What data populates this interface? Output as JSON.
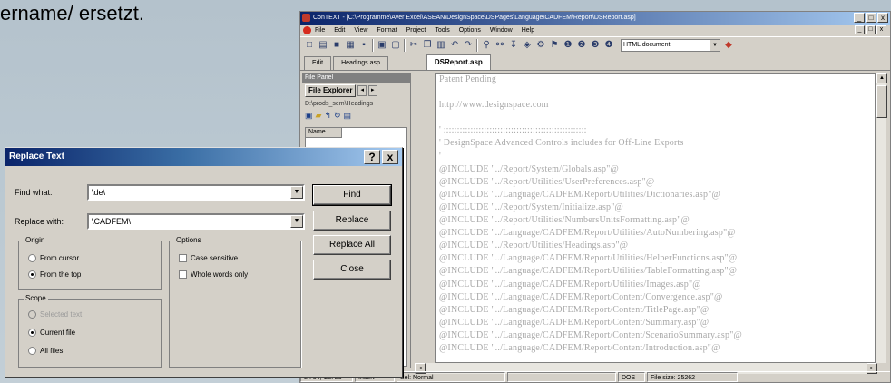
{
  "slide": {
    "caption": "ername/ ersetzt."
  },
  "window": {
    "title": "ConTEXT - [C:\\Programme\\Aver Excel\\ASEAN\\DesignSpace\\DSPages\\Language\\CADFEM\\Report\\DSReport.asp]",
    "controls": [
      "_",
      "□",
      "x"
    ],
    "menu": [
      "File",
      "Edit",
      "View",
      "Format",
      "Project",
      "Tools",
      "Options",
      "Window",
      "Help"
    ],
    "doc_type": "HTML document",
    "tabs": [
      "Edit",
      "Headings.asp",
      "DSReport.asp"
    ],
    "file_panel": {
      "title": "File Panel",
      "tab": "File Explorer",
      "path": "D:\\prods_sem\\Headings",
      "col_header": "Name"
    },
    "code_lines": [
      "Patent Pending",
      "",
      "http://www.designspace.com",
      "",
      "' :::::::::::::::::::::::::::::::::::::::::::::::::::::",
      "' DesignSpace Advanced Controls includes for Off-Line Exports",
      "'",
      "@INCLUDE \"../Report/System/Globals.asp\"@",
      "@INCLUDE \"../Report/Utilities/UserPreferences.asp\"@",
      "@INCLUDE \"../Language/CADFEM/Report/Utilities/Dictionaries.asp\"@",
      "@INCLUDE \"../Report/System/Initialize.asp\"@",
      "@INCLUDE \"../Report/Utilities/NumbersUnitsFormatting.asp\"@",
      "@INCLUDE \"../Language/CADFEM/Report/Utilities/AutoNumbering.asp\"@",
      "@INCLUDE \"../Report/Utilities/Headings.asp\"@",
      "@INCLUDE \"../Language/CADFEM/Report/Utilities/HelperFunctions.asp\"@",
      "@INCLUDE \"../Language/CADFEM/Report/Utilities/TableFormatting.asp\"@",
      "@INCLUDE \"../Language/CADFEM/Report/Utilities/Images.asp\"@",
      "@INCLUDE \"../Language/CADFEM/Report/Content/Convergence.asp\"@",
      "@INCLUDE \"../Language/CADFEM/Report/Content/TitlePage.asp\"@",
      "@INCLUDE \"../Language/CADFEM/Report/Content/Summary.asp\"@",
      "@INCLUDE \"../Language/CADFEM/Report/Content/ScenarioSummary.asp\"@",
      "@INCLUDE \"../Language/CADFEM/Report/Content/Introduction.asp\"@"
    ],
    "status": [
      "Ln 34, Col 23",
      "Insert",
      "Sel: Normal",
      "",
      "DOS",
      "File size: 25262"
    ]
  },
  "dialog": {
    "title": "Replace Text",
    "help_btn": "?",
    "close_btn": "x",
    "find_label": "Find what:",
    "find_value": "\\de\\",
    "replace_label": "Replace with:",
    "replace_value": "\\CADFEM\\",
    "origin": {
      "title": "Origin",
      "opt1": "From cursor",
      "opt2": "From the top"
    },
    "options": {
      "title": "Options",
      "opt1": "Case sensitive",
      "opt2": "Whole words only"
    },
    "scope": {
      "title": "Scope",
      "opt1": "Selected text",
      "opt2": "Current file",
      "opt3": "All files"
    },
    "buttons": {
      "find": "Find",
      "replace": "Replace",
      "replace_all": "Replace All",
      "close": "Close"
    }
  }
}
